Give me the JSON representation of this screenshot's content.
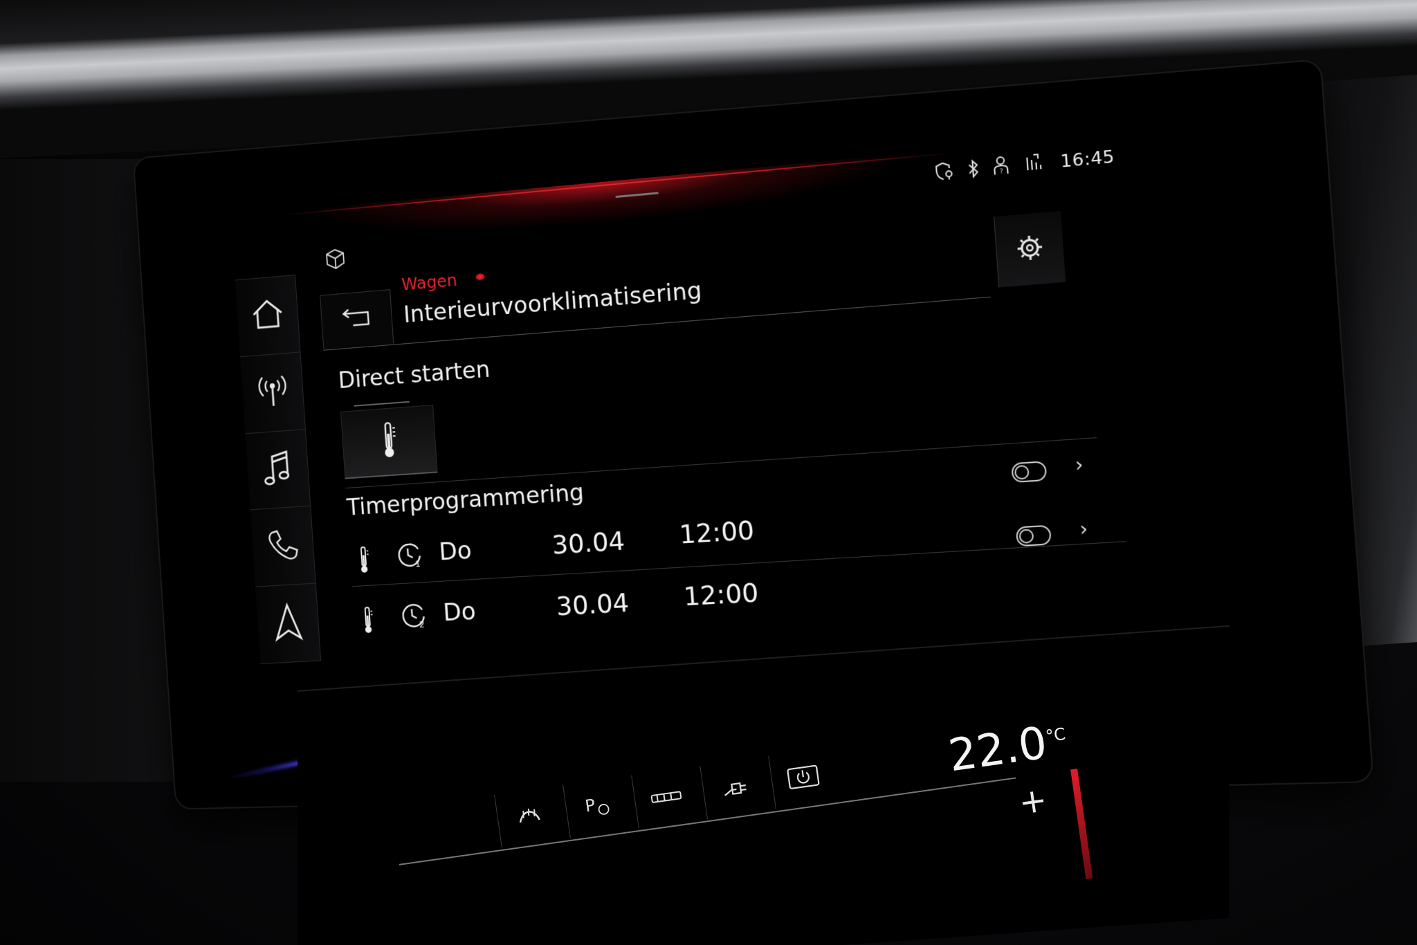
{
  "status_bar": {
    "time": "16:45",
    "icons": [
      "shield-location-icon",
      "bluetooth-icon",
      "person-help-icon",
      "data-transfer-icon"
    ]
  },
  "header": {
    "breadcrumb": "Wagen",
    "title": "Interieurvoorklimatisering"
  },
  "sidebar": {
    "items": [
      "home-icon",
      "radio-icon",
      "music-icon",
      "phone-icon",
      "navigation-icon"
    ]
  },
  "direct": {
    "heading": "Direct starten"
  },
  "timer": {
    "heading": "Timerprogrammering",
    "rows": [
      {
        "timer_number": "1",
        "day": "Do",
        "date": "30.04",
        "time": "12:00",
        "enabled": false
      },
      {
        "timer_number": "2",
        "day": "Do",
        "date": "30.04",
        "time": "12:00",
        "enabled": false
      }
    ]
  },
  "climate": {
    "temperature": "22.0",
    "unit": "°C",
    "plus_label": "+",
    "items": [
      "defrost-icon",
      "parking-heater-icon",
      "seat-heating-icon",
      "plug-icon",
      "power-icon"
    ]
  },
  "colors": {
    "accent_red": "#e8232d",
    "background": "#000000",
    "text": "#f2f2f2"
  }
}
